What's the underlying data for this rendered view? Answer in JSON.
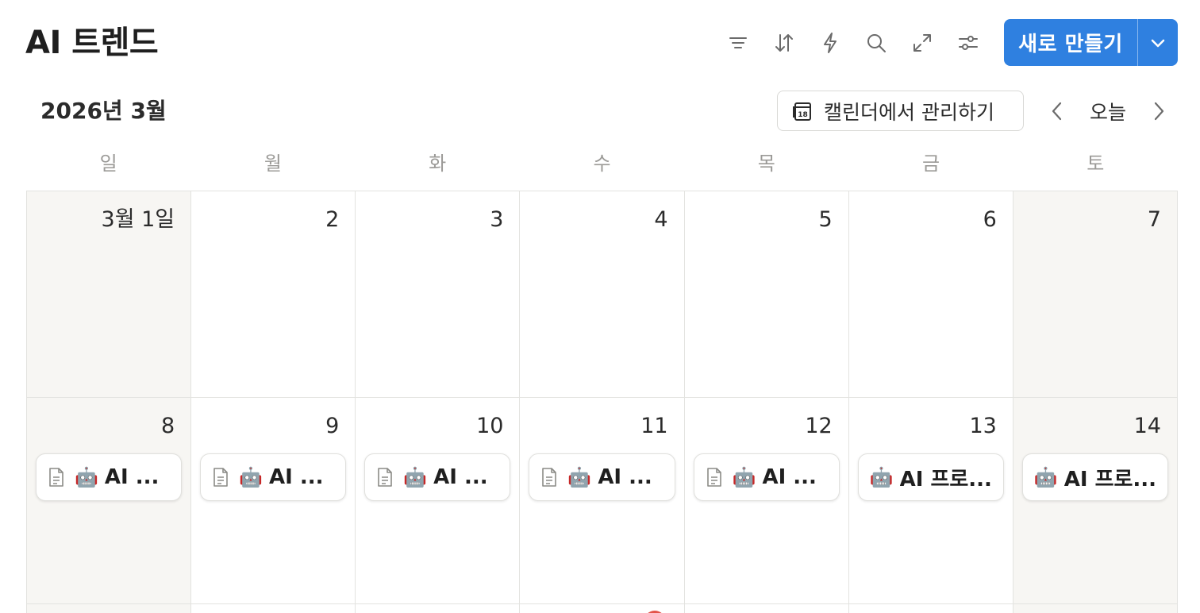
{
  "header": {
    "title": "AI 트렌드",
    "toolbar_icons": [
      "filter-icon",
      "sort-icon",
      "lightning-icon",
      "search-icon",
      "expand-icon",
      "settings-icon"
    ],
    "new_button_label": "새로 만들기",
    "accent_color": "#2f80e0"
  },
  "calendar": {
    "month_label": "2026년 3월",
    "manage_label": "캘린더에서 관리하기",
    "today_label": "오늘",
    "weekdays": [
      "일",
      "월",
      "화",
      "수",
      "목",
      "금",
      "토"
    ],
    "weeks": [
      {
        "days": [
          {
            "num": "3월 1일",
            "weekend": true
          },
          {
            "num": "2"
          },
          {
            "num": "3"
          },
          {
            "num": "4"
          },
          {
            "num": "5"
          },
          {
            "num": "6"
          },
          {
            "num": "7",
            "weekend": true
          }
        ]
      },
      {
        "days": [
          {
            "num": "8",
            "weekend": true,
            "event": {
              "doc": true,
              "emoji": "🤖",
              "text": "AI ..."
            }
          },
          {
            "num": "9",
            "event": {
              "doc": true,
              "emoji": "🤖",
              "text": "AI ..."
            }
          },
          {
            "num": "10",
            "event": {
              "doc": true,
              "emoji": "🤖",
              "text": "AI ..."
            }
          },
          {
            "num": "11",
            "event": {
              "doc": true,
              "emoji": "🤖",
              "text": "AI ..."
            }
          },
          {
            "num": "12",
            "event": {
              "doc": true,
              "emoji": "🤖",
              "text": "AI ..."
            }
          },
          {
            "num": "13",
            "event": {
              "doc": false,
              "emoji": "🤖",
              "text": "AI 프로..."
            }
          },
          {
            "num": "14",
            "weekend": true,
            "event": {
              "doc": false,
              "emoji": "🤖",
              "text": "AI 프로..."
            }
          }
        ]
      }
    ]
  }
}
